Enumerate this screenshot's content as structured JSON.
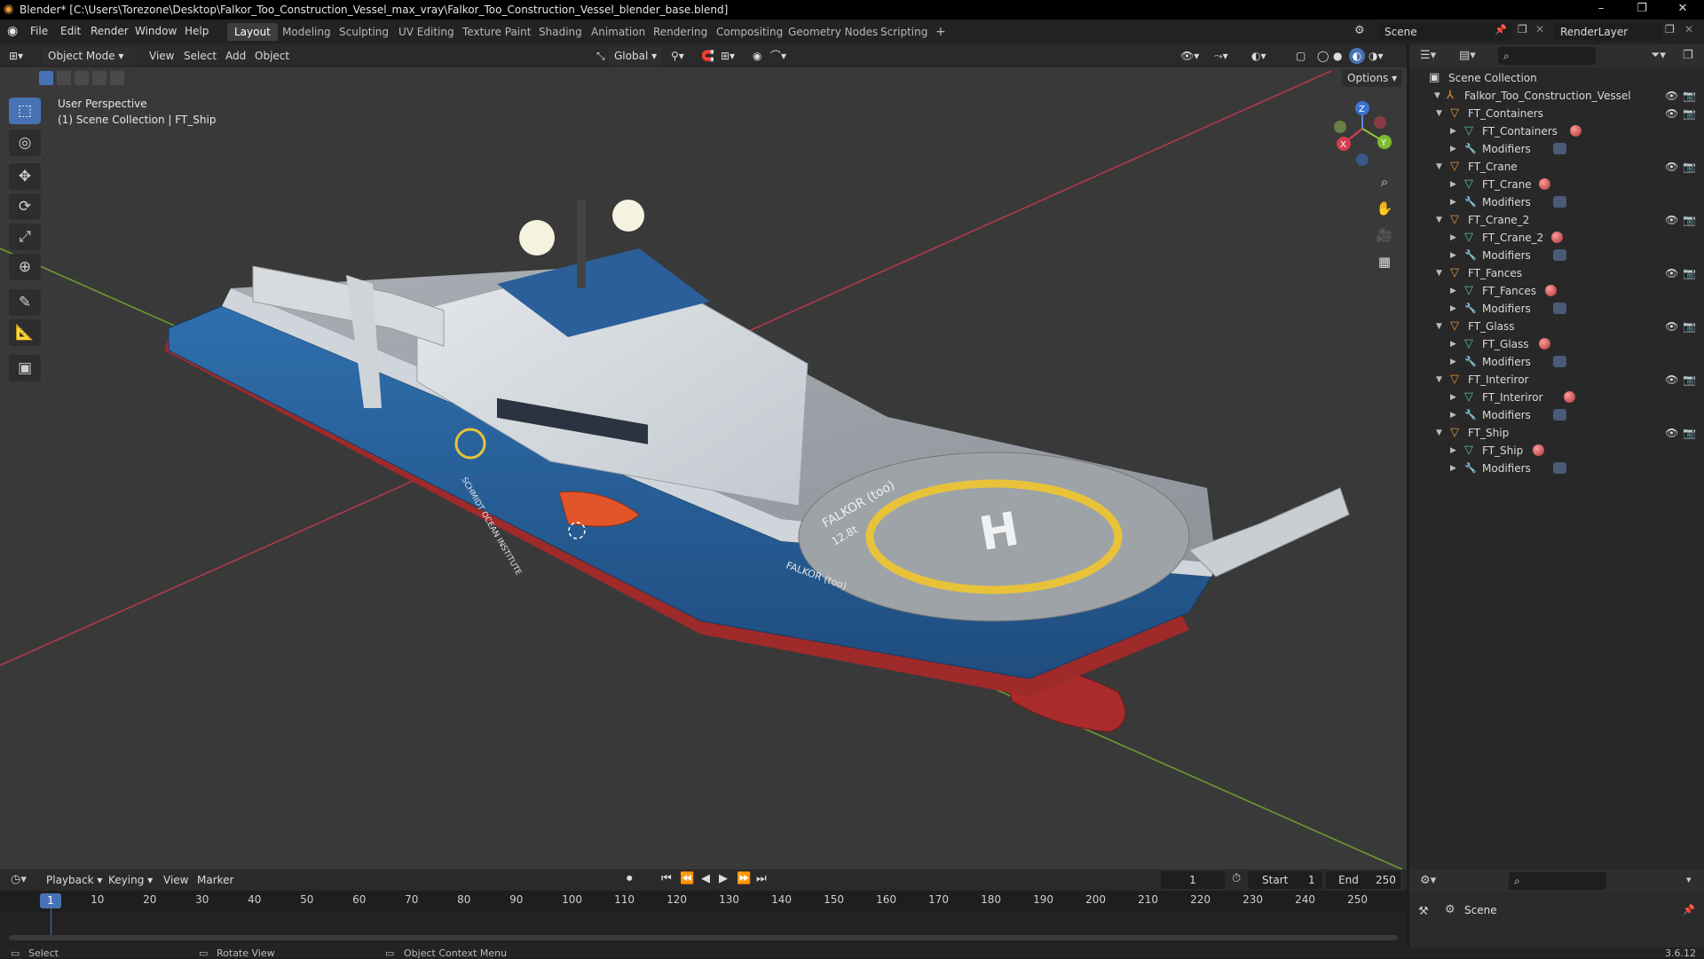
{
  "titlebar": {
    "title": "Blender* [C:\\Users\\Torezone\\Desktop\\Falkor_Too_Construction_Vessel_max_vray\\Falkor_Too_Construction_Vessel_blender_base.blend]",
    "minimize": "–",
    "restore": "❐",
    "close": "✕"
  },
  "menu": [
    "File",
    "Edit",
    "Render",
    "Window",
    "Help"
  ],
  "workspaces": [
    "Layout",
    "Modeling",
    "Sculpting",
    "UV Editing",
    "Texture Paint",
    "Shading",
    "Animation",
    "Rendering",
    "Compositing",
    "Geometry Nodes",
    "Scripting"
  ],
  "workspace_add": "+",
  "scene": "Scene",
  "render_layer": "RenderLayer",
  "viewport": {
    "mode": "Object Mode",
    "menus": [
      "View",
      "Select",
      "Add",
      "Object"
    ],
    "transform": "Global",
    "options": "Options",
    "perspective": "User Perspective",
    "context": "(1) Scene Collection | FT_Ship",
    "gizmo": {
      "x": "X",
      "y": "Y",
      "z": "Z"
    },
    "ship_name": "FALKOR (too)",
    "heli_mark": "H",
    "heli_text": "FALKOR (too)",
    "heli_num": "12.8t",
    "hull_text": "SCHMIDT OCEAN INSTITUTE"
  },
  "outliner": {
    "root": "Scene Collection",
    "collection": "Falkor_Too_Construction_Vessel",
    "modifiers": "Modifiers",
    "objects": [
      {
        "name": "FT_Containers",
        "mesh": "FT_Containers"
      },
      {
        "name": "FT_Crane",
        "mesh": "FT_Crane"
      },
      {
        "name": "FT_Crane_2",
        "mesh": "FT_Crane_2"
      },
      {
        "name": "FT_Fances",
        "mesh": "FT_Fances"
      },
      {
        "name": "FT_Glass",
        "mesh": "FT_Glass"
      },
      {
        "name": "FT_Interiror",
        "mesh": "FT_Interiror"
      },
      {
        "name": "FT_Ship",
        "mesh": "FT_Ship"
      }
    ]
  },
  "timeline": {
    "menus": [
      "Playback",
      "Keying",
      "View",
      "Marker"
    ],
    "current_frame": "1",
    "start_label": "Start",
    "start": "1",
    "end_label": "End",
    "end": "250",
    "ticks": [
      "10",
      "20",
      "30",
      "40",
      "50",
      "60",
      "70",
      "80",
      "90",
      "100",
      "110",
      "120",
      "130",
      "140",
      "150",
      "160",
      "170",
      "180",
      "190",
      "200",
      "210",
      "220",
      "230",
      "240",
      "250"
    ]
  },
  "properties": {
    "scene": "Scene"
  },
  "status": {
    "select": "Select",
    "rotate": "Rotate View",
    "context_menu": "Object Context Menu",
    "version": "3.6.12"
  },
  "colors": {
    "accent": "#4772b3",
    "hull": "#2d6aa8",
    "helipad_ring": "#e8c33a",
    "boot_top": "#b02a2a",
    "outliner_object": "#e8903c",
    "mesh": "#4fc3a0"
  }
}
